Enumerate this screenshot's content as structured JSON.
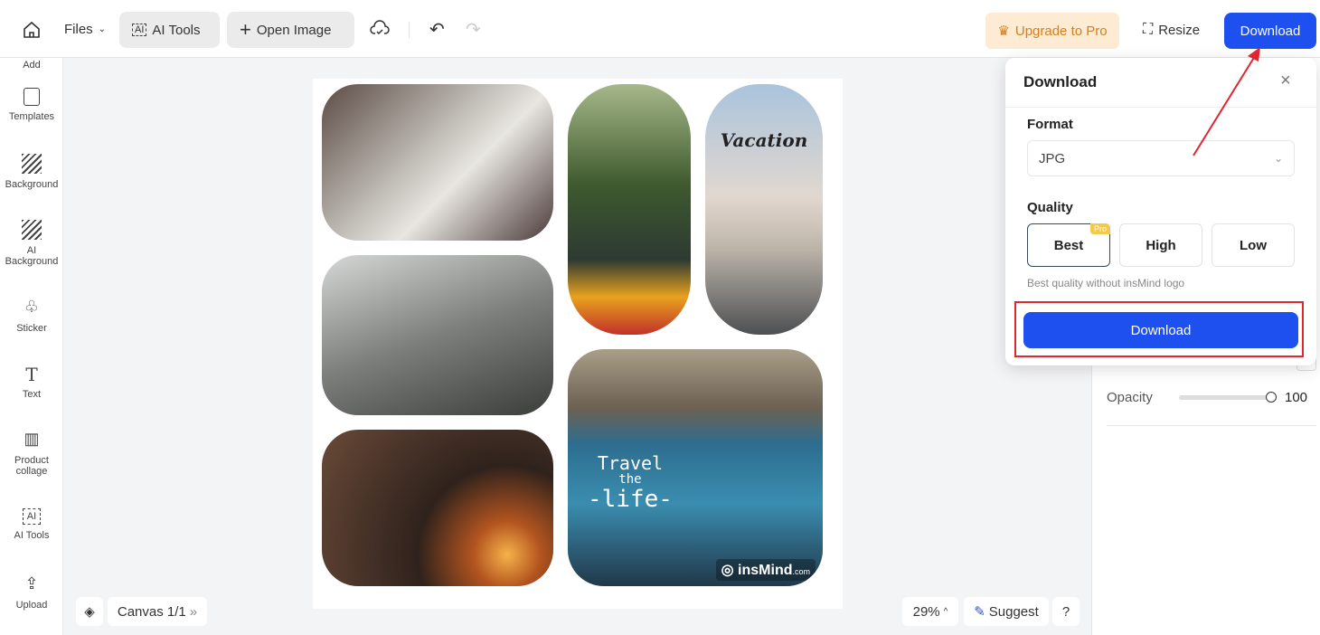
{
  "toolbar": {
    "files": "Files",
    "ai_tools": "AI Tools",
    "open_image": "Open Image",
    "upgrade": "Upgrade to Pro",
    "resize": "Resize",
    "download": "Download"
  },
  "sidebar": {
    "items": [
      {
        "label": "Add"
      },
      {
        "label": "Templates"
      },
      {
        "label": "Background"
      },
      {
        "label": "AI Background"
      },
      {
        "label": "Sticker"
      },
      {
        "label": "Text"
      },
      {
        "label": "Product collage"
      },
      {
        "label": "AI Tools"
      },
      {
        "label": "Upload"
      }
    ]
  },
  "canvas": {
    "vacation_text": "Vacation",
    "travel_text": [
      "Travel",
      "the",
      "-life-"
    ],
    "watermark": "insMind",
    "watermark_suffix": ".com"
  },
  "bottom": {
    "canvas_label": "Canvas 1/1",
    "zoom": "29%",
    "suggest": "Suggest",
    "help": "?"
  },
  "right_panel": {
    "opacity_label": "Opacity",
    "opacity_value": "100",
    "opacity_fraction": 1.0
  },
  "download_popup": {
    "title": "Download",
    "format_label": "Format",
    "format_value": "JPG",
    "quality_label": "Quality",
    "quality_options": [
      "Best",
      "High",
      "Low"
    ],
    "selected_quality": "Best",
    "pro_badge": "Pro",
    "hint": "Best quality without insMind logo",
    "download_button": "Download"
  },
  "colors": {
    "accent": "#1e50f0",
    "upgrade_bg": "#fdebd3",
    "upgrade_text": "#d2801e",
    "annotation": "#e0262f",
    "pro_badge": "#f2c94c"
  }
}
